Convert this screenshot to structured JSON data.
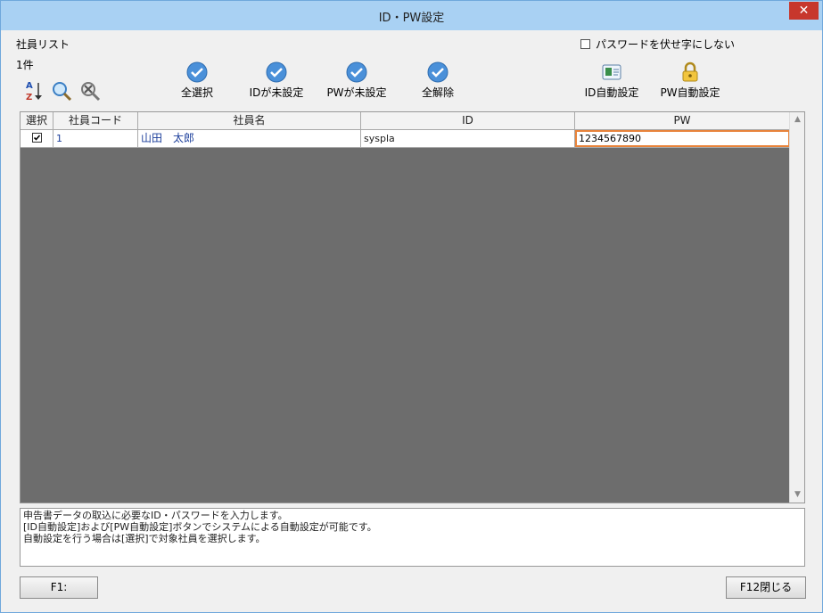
{
  "window": {
    "title": "ID・PW設定",
    "close_glyph": "✕"
  },
  "list": {
    "label": "社員リスト",
    "count": "1件"
  },
  "mask_option": {
    "label": "パスワードを伏せ字にしない",
    "checked": false
  },
  "toolbar": {
    "select_all": "全選択",
    "id_unset": "IDが未設定",
    "pw_unset": "PWが未設定",
    "clear_all": "全解除",
    "id_auto": "ID自動設定",
    "pw_auto": "PW自動設定"
  },
  "icons": [
    "sort-az-icon",
    "search-icon",
    "clear-search-icon",
    "check-icon",
    "id-card-icon",
    "padlock-icon"
  ],
  "colors": {
    "accent_blue": "#4a90d9",
    "focus_orange": "#e8833a",
    "grid_bg": "#6d6d6d"
  },
  "table": {
    "headers": [
      "選択",
      "社員コード",
      "社員名",
      "ID",
      "PW"
    ],
    "rows": [
      {
        "selected": true,
        "code": "1",
        "name": "山田　太郎",
        "id": "syspla",
        "pw": "1234567890"
      }
    ]
  },
  "description": [
    "申告書データの取込に必要なID・パスワードを入力します。",
    "[ID自動設定]および[PW自動設定]ボタンでシステムによる自動設定が可能です。",
    "自動設定を行う場合は[選択]で対象社員を選択します。"
  ],
  "footer": {
    "f1": "F1:",
    "f12": "F12閉じる"
  }
}
